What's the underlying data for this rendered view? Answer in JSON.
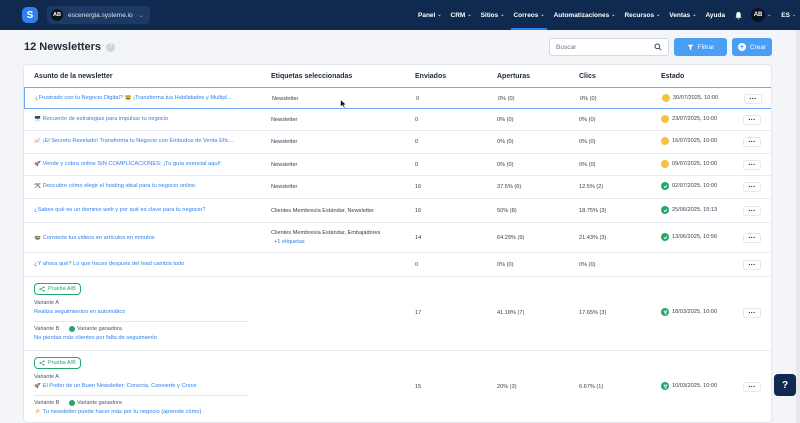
{
  "topbar": {
    "logo_letter": "S",
    "site_avatar": "AB",
    "site_name": "escenergia.systeme.io",
    "nav": [
      {
        "label": "Panel"
      },
      {
        "label": "CRM"
      },
      {
        "label": "Sitios"
      },
      {
        "label": "Correos",
        "active": true
      },
      {
        "label": "Automatizaciones"
      },
      {
        "label": "Recursos"
      },
      {
        "label": "Ventas"
      },
      {
        "label": "Ayuda"
      }
    ],
    "user_avatar": "AB",
    "language": "ES"
  },
  "header": {
    "title": "12 Newsletters",
    "info": "?",
    "search_placeholder": "Buscar",
    "filter_label": "Filtrar",
    "create_label": "Crear"
  },
  "table": {
    "columns": {
      "subject": "Asunto de la newsletter",
      "tags": "Etiquetas seleccionadas",
      "sent": "Enviados",
      "opens": "Aperturas",
      "clicks": "Clics",
      "status": "Estado"
    },
    "rows": [
      {
        "subject": "¿Frustrado con tu Negocio Digital? 😩 ¡Transforma tus Habilidades y Multipl...",
        "tags": "Newsletter",
        "sent": "0",
        "opens": "0% (0)",
        "clicks": "0% (0)",
        "status": "scheduled",
        "date": "30/07/2025, 10:00"
      },
      {
        "subject": "🖥️ Recuento de estrategias para impulsar tu negocio",
        "tags": "Newsletter",
        "sent": "0",
        "opens": "0% (0)",
        "clicks": "0% (0)",
        "status": "scheduled",
        "date": "23/07/2025, 10:00"
      },
      {
        "subject": "📈 ¡El Secreto Revelado! Transforma tu Negocio con Embudos de Venta Efic...",
        "tags": "Newsletter",
        "sent": "0",
        "opens": "0% (0)",
        "clicks": "0% (0)",
        "status": "scheduled",
        "date": "16/07/2025, 10:00"
      },
      {
        "subject": "🚀 Vende y cobra online SIN COMPLICACIONES: ¡Tu guía esencial aquí!",
        "tags": "Newsletter",
        "sent": "0",
        "opens": "0% (0)",
        "clicks": "0% (0)",
        "status": "scheduled",
        "date": "09/07/2025, 10:00"
      },
      {
        "subject": "🛠️ Descubre cómo elegir el hosting ideal para tu negocio online.",
        "tags": "Newsletter",
        "sent": "16",
        "opens": "37.5% (6)",
        "clicks": "12.5% (2)",
        "status": "sent",
        "date": "02/07/2025, 10:00"
      },
      {
        "subject": "¿Sabes qué es un dominio web y por qué es clave para tu negocio?",
        "tags": "Clientes Membresía Estándar, Newsletter",
        "sent": "16",
        "opens": "50% (8)",
        "clicks": "18.75% (3)",
        "status": "sent",
        "date": "25/06/2025, 15:13"
      },
      {
        "subject": "🍲 Convierte tus videos en artículos en minutos",
        "tags": "Clientes Membresía Estándar, Embajadores",
        "tags_more": "+1 etiquetas",
        "sent": "14",
        "opens": "64.29% (9)",
        "clicks": "21.43% (3)",
        "status": "sent",
        "date": "13/06/2025, 10:56"
      },
      {
        "subject": "¿Y ahora qué? Lo que haces después del lead cambia todo",
        "tags": "",
        "sent": "0",
        "opens": "0% (0)",
        "clicks": "0% (0)",
        "status": "none",
        "date": ""
      }
    ],
    "ab_rows": [
      {
        "badge": "Prueba A/B",
        "variant_a_label": "Variante A",
        "variant_a": "Realiza seguimientos en automático",
        "variant_b_label": "Variante B",
        "winner": "Variante ganadora",
        "variant_b": "No pierdas más clientes por falta de seguimiento",
        "sent": "17",
        "opens": "41.18% (7)",
        "clicks": "17.65% (3)",
        "date": "18/03/2025, 10:00"
      },
      {
        "badge": "Prueba A/B",
        "variant_a_label": "Variante A",
        "variant_a": "🚀 El Poder de un Buen Newsletter: Conecta, Convierte y Crece",
        "variant_b_label": "Variante B",
        "winner": "Variante ganadora",
        "variant_b": "⚡ Tu newsletter puede hacer más por tu negocio (aprende cómo)",
        "sent": "15",
        "opens": "20% (3)",
        "clicks": "6.67% (1)",
        "date": "10/03/2025, 10:00"
      }
    ],
    "more": "..."
  },
  "help_label": "?"
}
